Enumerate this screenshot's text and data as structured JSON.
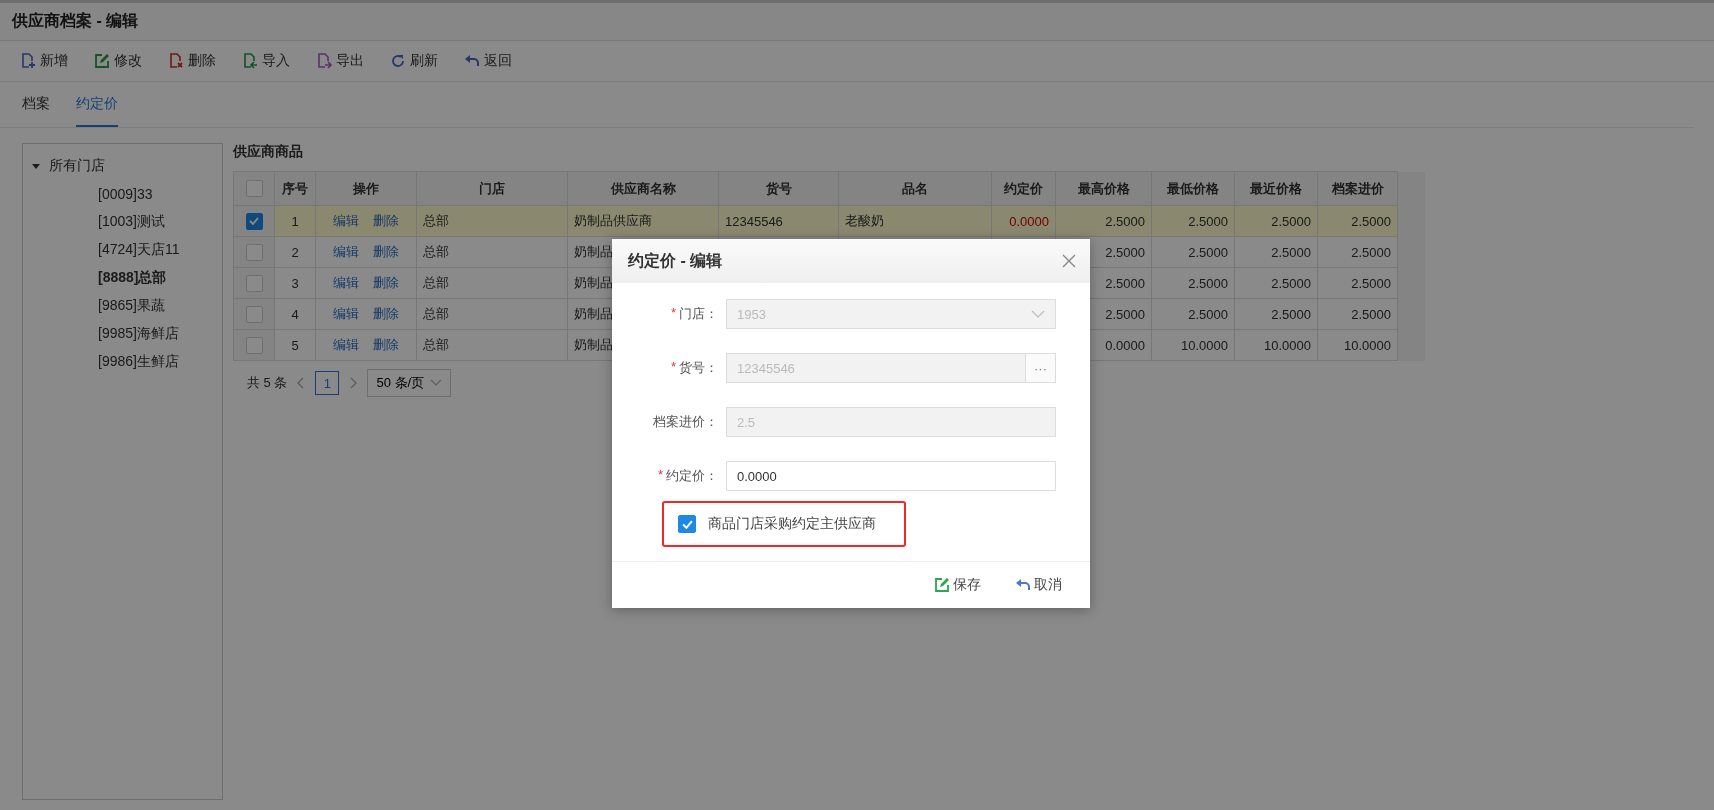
{
  "window": {
    "title": "供应商档案 - 编辑"
  },
  "toolbar": [
    {
      "kind": "new",
      "label": "新增"
    },
    {
      "kind": "edit",
      "label": "修改"
    },
    {
      "kind": "delete",
      "label": "删除"
    },
    {
      "kind": "import",
      "label": "导入"
    },
    {
      "kind": "export",
      "label": "导出"
    },
    {
      "kind": "refresh",
      "label": "刷新"
    },
    {
      "kind": "back",
      "label": "返回"
    }
  ],
  "tabs": [
    {
      "label": "档案",
      "selected": false
    },
    {
      "label": "约定价",
      "selected": true
    }
  ],
  "store_tree": {
    "label": "所有门店",
    "expanded": true,
    "children": [
      {
        "label": "[0009]33",
        "selected": false
      },
      {
        "label": "[1003]测试",
        "selected": false
      },
      {
        "label": "[4724]天店11",
        "selected": false
      },
      {
        "label": "[8888]总部",
        "selected": true
      },
      {
        "label": "[9865]果蔬",
        "selected": false
      },
      {
        "label": "[9985]海鲜店",
        "selected": false
      },
      {
        "label": "[9986]生鲜店",
        "selected": false
      }
    ]
  },
  "table": {
    "title": "供应商商品",
    "all_checked": false,
    "columns": [
      "序号",
      "操作",
      "门店",
      "供应商名称",
      "货号",
      "品名",
      "约定价",
      "最高价格",
      "最低价格",
      "最近价格",
      "档案进价"
    ],
    "rows": [
      {
        "selected": true,
        "index": "1",
        "actions": [
          "编辑",
          "删除"
        ],
        "store": "总部",
        "supplier": "奶制品供应商",
        "code": "12345546",
        "name": "老酸奶",
        "agreed_price": "0.0000",
        "max_price": "2.5000",
        "min_price": "2.5000",
        "recent_price": "2.5000",
        "file_price": "2.5000"
      },
      {
        "selected": false,
        "index": "2",
        "actions": [
          "编辑",
          "删除"
        ],
        "store": "总部",
        "supplier": "奶制品",
        "max_price": "2.5000",
        "min_price": "2.5000",
        "recent_price": "2.5000",
        "file_price": "2.5000"
      },
      {
        "selected": false,
        "index": "3",
        "actions": [
          "编辑",
          "删除"
        ],
        "store": "总部",
        "supplier": "奶制品",
        "max_price": "2.5000",
        "min_price": "2.5000",
        "recent_price": "2.5000",
        "file_price": "2.5000"
      },
      {
        "selected": false,
        "index": "4",
        "actions": [
          "编辑",
          "删除"
        ],
        "store": "总部",
        "supplier": "奶制品",
        "max_price": "2.5000",
        "min_price": "2.5000",
        "recent_price": "2.5000",
        "file_price": "2.5000"
      },
      {
        "selected": false,
        "index": "5",
        "actions": [
          "编辑",
          "删除"
        ],
        "store": "总部",
        "supplier": "奶制品",
        "max_price": "0.0000",
        "min_price": "10.0000",
        "recent_price": "10.0000",
        "file_price": "10.0000"
      }
    ]
  },
  "pagination": {
    "total": "共 5 条",
    "pages": [
      {
        "label": "1",
        "selected": true
      }
    ],
    "page_size": "50 条/页"
  },
  "dialog": {
    "title": "约定价 - 编辑",
    "fields": [
      {
        "kind": "select",
        "label": "门店：",
        "required_mark": "*",
        "disabled": true,
        "value": "1953"
      },
      {
        "kind": "lookup",
        "label": "货号：",
        "required_mark": "*",
        "disabled": true,
        "value": "12345546",
        "button": "···"
      },
      {
        "kind": "text",
        "label": "档案进价：",
        "disabled": true,
        "value": "2.5"
      },
      {
        "kind": "text",
        "label": "约定价：",
        "required_mark": "*",
        "disabled": false,
        "value": "0.0000"
      }
    ],
    "checkbox": {
      "label": "商品门店采购约定主供应商",
      "checked": true,
      "highlighted": true
    },
    "buttons": [
      {
        "kind": "save",
        "label": "保存"
      },
      {
        "kind": "cancel",
        "label": "取消"
      }
    ]
  }
}
